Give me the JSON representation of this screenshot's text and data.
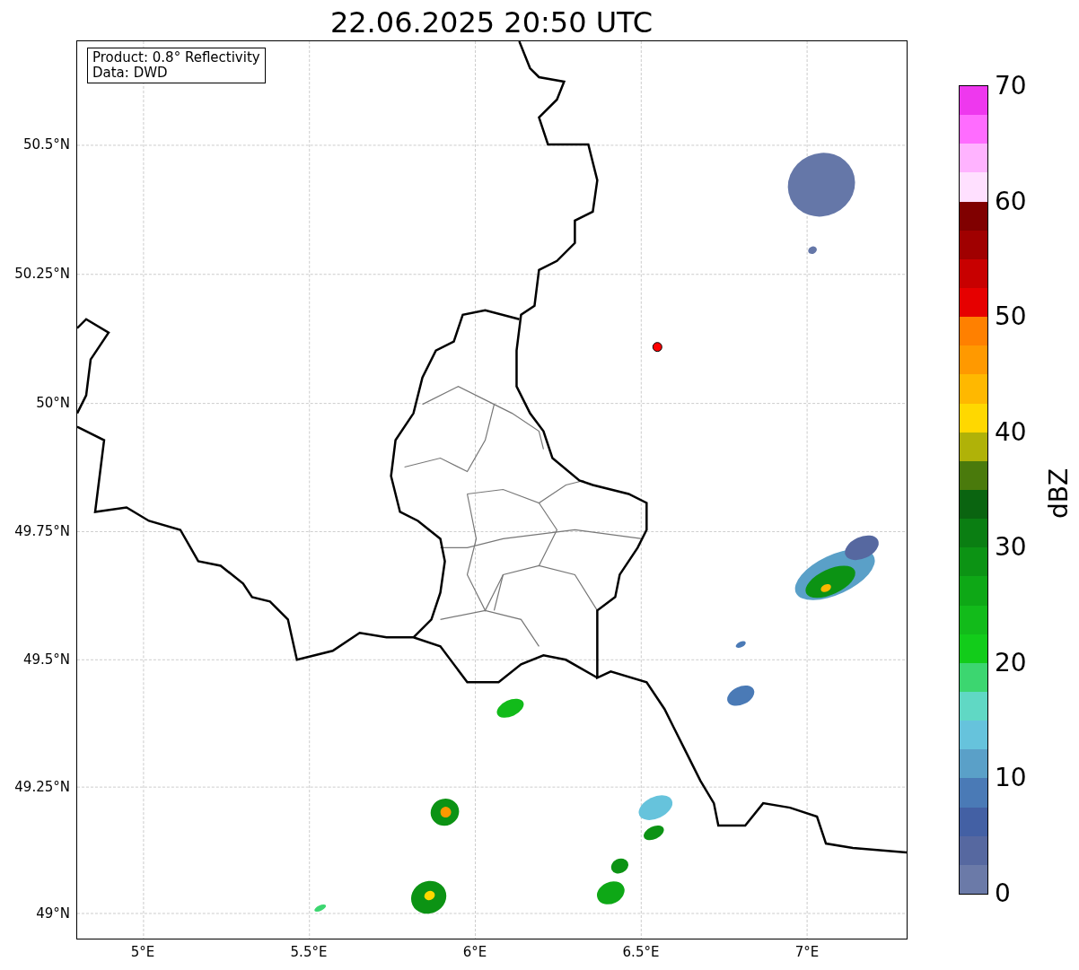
{
  "title": "22.06.2025 20:50 UTC",
  "info_box": [
    "Product: 0.8° Reflectivity",
    "Data: DWD"
  ],
  "y_ticks": [
    "50.5°N",
    "50.25°N",
    "50°N",
    "49.75°N",
    "49.5°N",
    "49.25°N",
    "49°N"
  ],
  "x_ticks": [
    "5°E",
    "5.5°E",
    "6°E",
    "6.5°E",
    "7°E"
  ],
  "colorbar": {
    "label": "dBZ",
    "ticks": [
      "70",
      "60",
      "50",
      "40",
      "30",
      "20",
      "10",
      "0"
    ],
    "bands": [
      {
        "color": "#ee38ee"
      },
      {
        "color": "#ff6cff"
      },
      {
        "color": "#ffb3ff"
      },
      {
        "color": "#ffe0ff"
      },
      {
        "color": "#800000"
      },
      {
        "color": "#a00000"
      },
      {
        "color": "#c80000"
      },
      {
        "color": "#e60000"
      },
      {
        "color": "#ff8000"
      },
      {
        "color": "#ff9900"
      },
      {
        "color": "#ffb800"
      },
      {
        "color": "#ffd800"
      },
      {
        "color": "#b0b208"
      },
      {
        "color": "#4a7a0c"
      },
      {
        "color": "#0a6410"
      },
      {
        "color": "#0a7e12"
      },
      {
        "color": "#0c9314"
      },
      {
        "color": "#0ea816"
      },
      {
        "color": "#12bb1a"
      },
      {
        "color": "#12cc1a"
      },
      {
        "color": "#3cd670"
      },
      {
        "color": "#60d8c4"
      },
      {
        "color": "#66c3dc"
      },
      {
        "color": "#5aa0c8"
      },
      {
        "color": "#4a7ab6"
      },
      {
        "color": "#4360a4"
      },
      {
        "color": "#5668a0"
      },
      {
        "color": "#6b7aa8"
      }
    ]
  }
}
